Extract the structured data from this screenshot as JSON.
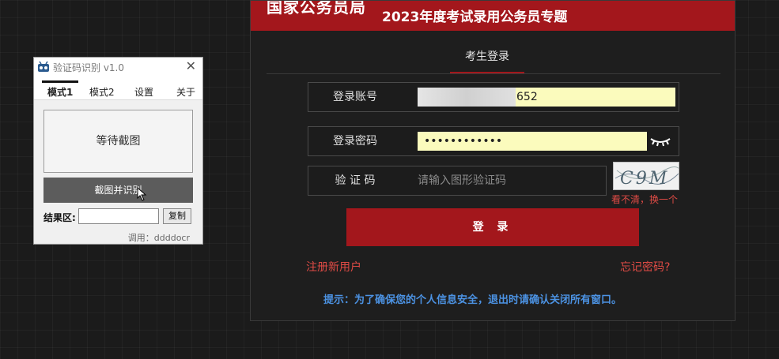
{
  "login": {
    "banner_org": "国家公务员局",
    "banner_subtitle": "2023年度考试录用公务员专题",
    "tab": "考生登录",
    "account": {
      "label": "登录账号",
      "value_visible_tail": "652"
    },
    "password": {
      "label": "登录密码",
      "value": "••••••••••••"
    },
    "captcha": {
      "label": "验 证 码",
      "placeholder": "请输入图形验证码",
      "image_text": "C9M",
      "refresh_label": "看不清，换一个"
    },
    "submit_label": "登 录",
    "register_link": "注册新用户",
    "forgot_link": "忘记密码?",
    "tip": "提示：为了确保您的个人信息安全，退出时请确认关闭所有窗口。"
  },
  "ocr_tool": {
    "title": "验证码识别 v1.0",
    "tabs": [
      "模式1",
      "模式2",
      "设置",
      "关于"
    ],
    "active_tab": "模式1",
    "status_text": "等待截图",
    "capture_button": "截图并识别",
    "result_label": "结果区:",
    "result_value": "",
    "copy_button": "复制",
    "engine_note": "调用：ddddocr"
  },
  "colors": {
    "brand_red": "#a3171c",
    "link_red": "#e04b45",
    "tip_blue": "#4c93e4",
    "input_yellow": "#fbfbbd"
  },
  "icons": [
    "app-icon",
    "close-icon",
    "eye-closed-icon",
    "cursor-icon"
  ]
}
